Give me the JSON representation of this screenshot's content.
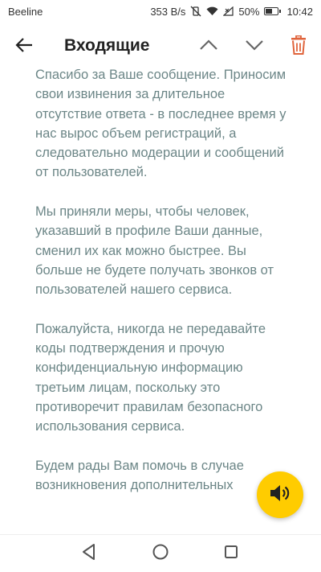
{
  "status_bar": {
    "carrier": "Beeline",
    "net_speed": "353 B/s",
    "battery": "50%",
    "time": "10:42"
  },
  "app_bar": {
    "title": "Входящие"
  },
  "message": {
    "paragraphs": [
      "Спасибо за Ваше сообщение. Приносим свои извинения за длительное отсутствие ответа - в последнее время у нас вырос объем регистраций, а следовательно модерации и сообщений от пользователей.",
      "Мы приняли меры, чтобы человек, указавший в профиле Ваши данные, сменил их как можно быстрее. Вы больше не будете получать звонков от пользователей нашего сервиса.",
      "Пожалуйста, никогда не передавайте коды подтверждения и прочую конфиденциальную информацию третьим лицам, поскольку это противоречит правилам безопасного использования сервиса.",
      "Будем рады Вам помочь в случае возникновения дополнительных"
    ]
  },
  "colors": {
    "accent": "#ffcc00",
    "delete": "#e0643c",
    "body_text": "#6c8687",
    "title_text": "#222222"
  },
  "icons": {
    "back": "arrow-left-icon",
    "up": "chevron-up-icon",
    "down": "chevron-down-icon",
    "delete": "trash-icon",
    "audio": "speaker-icon",
    "sys_back": "triangle-back-icon",
    "sys_home": "circle-home-icon",
    "sys_recent": "square-recent-icon"
  }
}
